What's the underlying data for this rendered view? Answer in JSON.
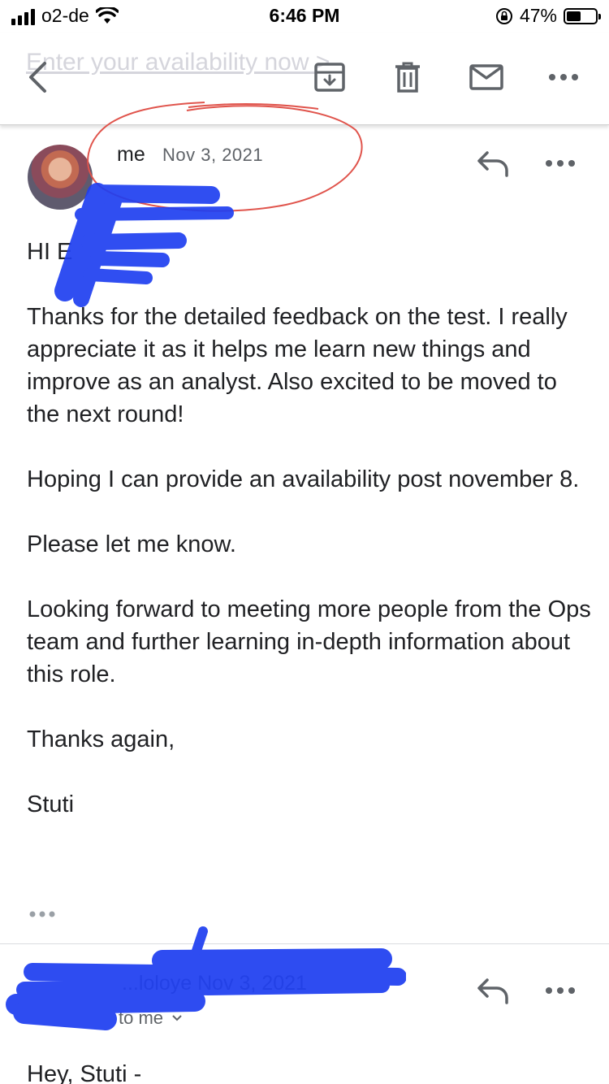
{
  "status_bar": {
    "carrier": "o2-de",
    "time": "6:46 PM",
    "battery_percent": "47%",
    "battery_level": 0.47,
    "icons": [
      "signal-icon",
      "wifi-icon",
      "rotation-lock-icon",
      "battery-icon"
    ]
  },
  "toolbar": {
    "subject_ghost": "Enter your availability now >",
    "icons": [
      "back-arrow-icon",
      "archive-icon",
      "trash-icon",
      "mail-icon",
      "more-horizontal-icon"
    ]
  },
  "message": {
    "sender": "me",
    "date": "Nov 3, 2021",
    "paragraphs": [
      "HI E",
      "Thanks for the detailed feedback on the test. I really appreciate it as it helps me learn new things and improve as an analyst. Also excited to be moved to the next round!",
      "Hoping I can provide an availability post november 8.",
      "Please let me know.",
      "Looking forward to meeting more people from the Ops team and further learning in-depth information about this role.",
      "Thanks again,",
      "Stuti"
    ]
  },
  "reply": {
    "sender_partial": "...loloye  Nov 3, 2021",
    "recipient": "to me",
    "greeting": "Hey, Stuti -"
  },
  "colors": {
    "annotation_red": "#e0544c",
    "redaction_blue": "#1f3ff0",
    "text_primary": "#202124",
    "text_secondary": "#5f6368"
  }
}
